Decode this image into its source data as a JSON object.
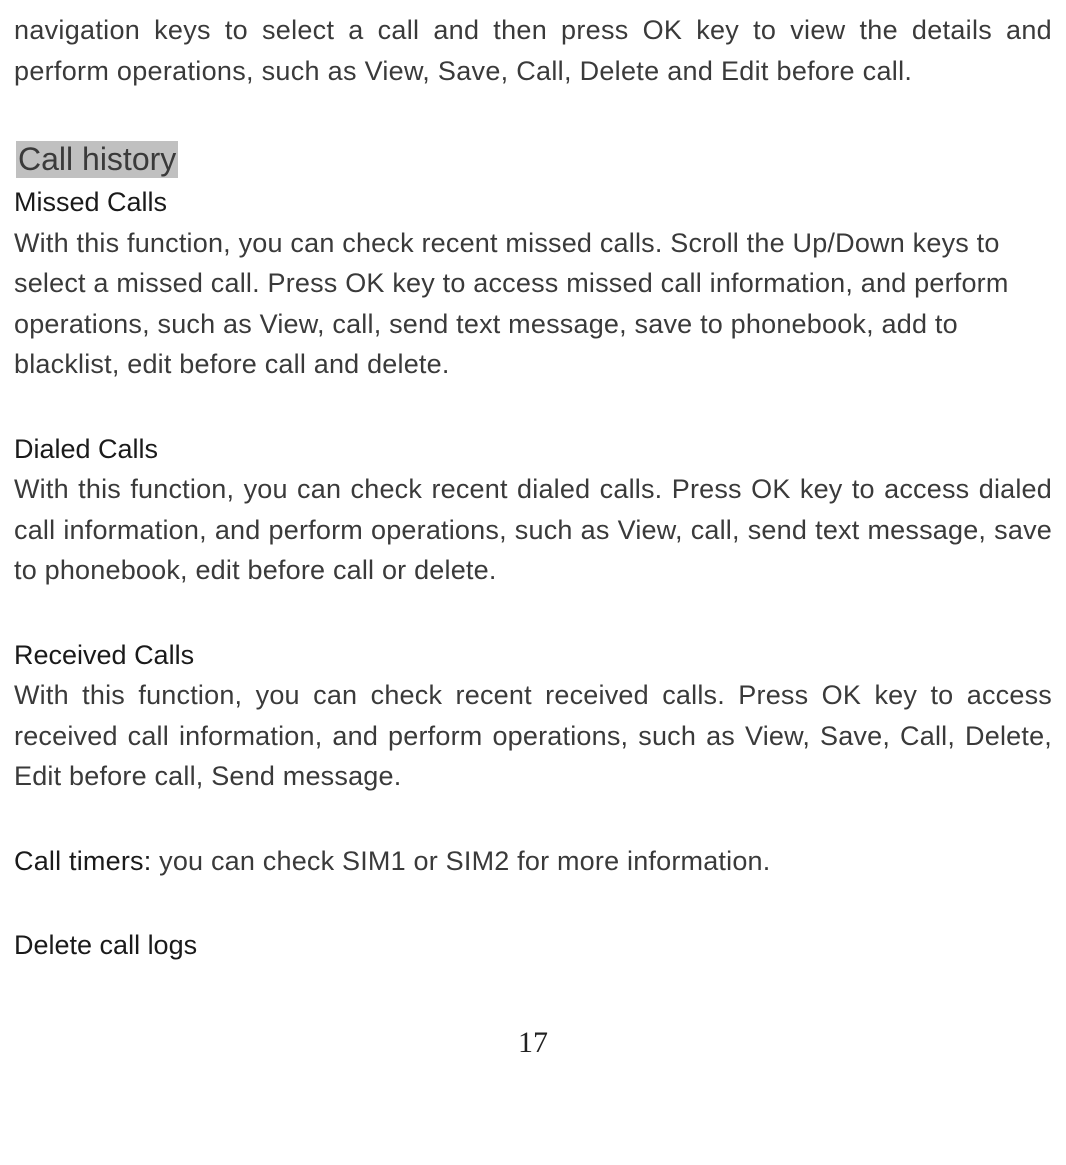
{
  "intro": "navigation keys to select a call and then press OK key to view the details and perform operations, such as View, Save, Call, Delete and Edit before call.",
  "section_title": "Call history",
  "sections": {
    "missed": {
      "heading": "Missed Calls",
      "body": "With this function, you can check recent missed calls. Scroll the Up/Down keys to select a missed call. Press OK key to access missed call information, and perform operations, such as View, call, send text message, save to phonebook, add to blacklist, edit before call and delete."
    },
    "dialed": {
      "heading": "Dialed Calls",
      "body": "With this function, you can check recent dialed calls. Press OK key to access dialed call information, and perform operations, such as View, call, send text message, save to phonebook, edit before call or delete."
    },
    "received": {
      "heading": "Received Calls",
      "body": "With this function, you can check recent received calls. Press OK key to access received call information, and perform operations, such as View, Save, Call, Delete, Edit before call, Send message."
    },
    "timers": {
      "label": "Call timers: ",
      "body": "you can check SIM1 or SIM2 for more information."
    },
    "delete": {
      "heading": "Delete call logs"
    }
  },
  "page_number": "17"
}
